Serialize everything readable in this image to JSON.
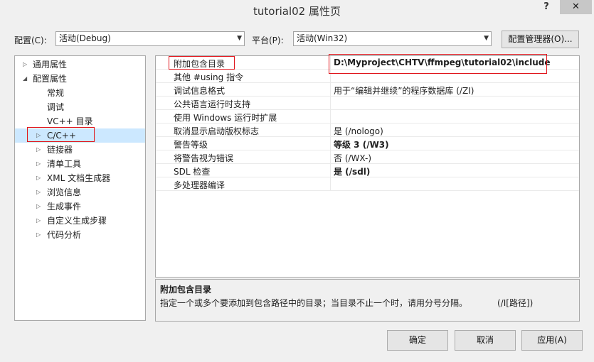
{
  "window": {
    "title": "tutorial02 属性页",
    "help": "?",
    "close": "✕"
  },
  "toolbar": {
    "config_label": "配置(C):",
    "config_value": "活动(Debug)",
    "platform_label": "平台(P):",
    "platform_value": "活动(Win32)",
    "config_manager_button": "配置管理器(O)..."
  },
  "tree": {
    "items": [
      {
        "label": "通用属性"
      },
      {
        "label": "配置属性"
      },
      {
        "label": "常规"
      },
      {
        "label": "调试"
      },
      {
        "label": "VC++ 目录"
      },
      {
        "label": "C/C++"
      },
      {
        "label": "链接器"
      },
      {
        "label": "清单工具"
      },
      {
        "label": "XML 文档生成器"
      },
      {
        "label": "浏览信息"
      },
      {
        "label": "生成事件"
      },
      {
        "label": "自定义生成步骤"
      },
      {
        "label": "代码分析"
      }
    ],
    "selected": "C/C++"
  },
  "grid": {
    "rows": [
      {
        "name": "附加包含目录",
        "value": "D:\\Myproject\\CHTV\\ffmpeg\\tutorial02\\include",
        "bold": true
      },
      {
        "name": "其他 #using 指令",
        "value": ""
      },
      {
        "name": "调试信息格式",
        "value": "用于“编辑并继续”的程序数据库 (/ZI)"
      },
      {
        "name": "公共语言运行时支持",
        "value": ""
      },
      {
        "name": "使用 Windows 运行时扩展",
        "value": ""
      },
      {
        "name": "取消显示启动版权标志",
        "value": "是 (/nologo)"
      },
      {
        "name": "警告等级",
        "value": "等级 3 (/W3)",
        "bold": true
      },
      {
        "name": "将警告视为错误",
        "value": "否 (/WX-)"
      },
      {
        "name": "SDL 检查",
        "value": "是 (/sdl)",
        "bold": true
      },
      {
        "name": "多处理器编译",
        "value": ""
      }
    ]
  },
  "description": {
    "title": "附加包含目录",
    "text": "指定一个或多个要添加到包含路径中的目录；当目录不止一个时，请用分号分隔。",
    "switch": "(/I[路径])"
  },
  "buttons": {
    "ok": "确定",
    "cancel": "取消",
    "apply": "应用(A)"
  },
  "colors": {
    "highlight_box": "#e0151c",
    "selection": "#cce8ff"
  }
}
